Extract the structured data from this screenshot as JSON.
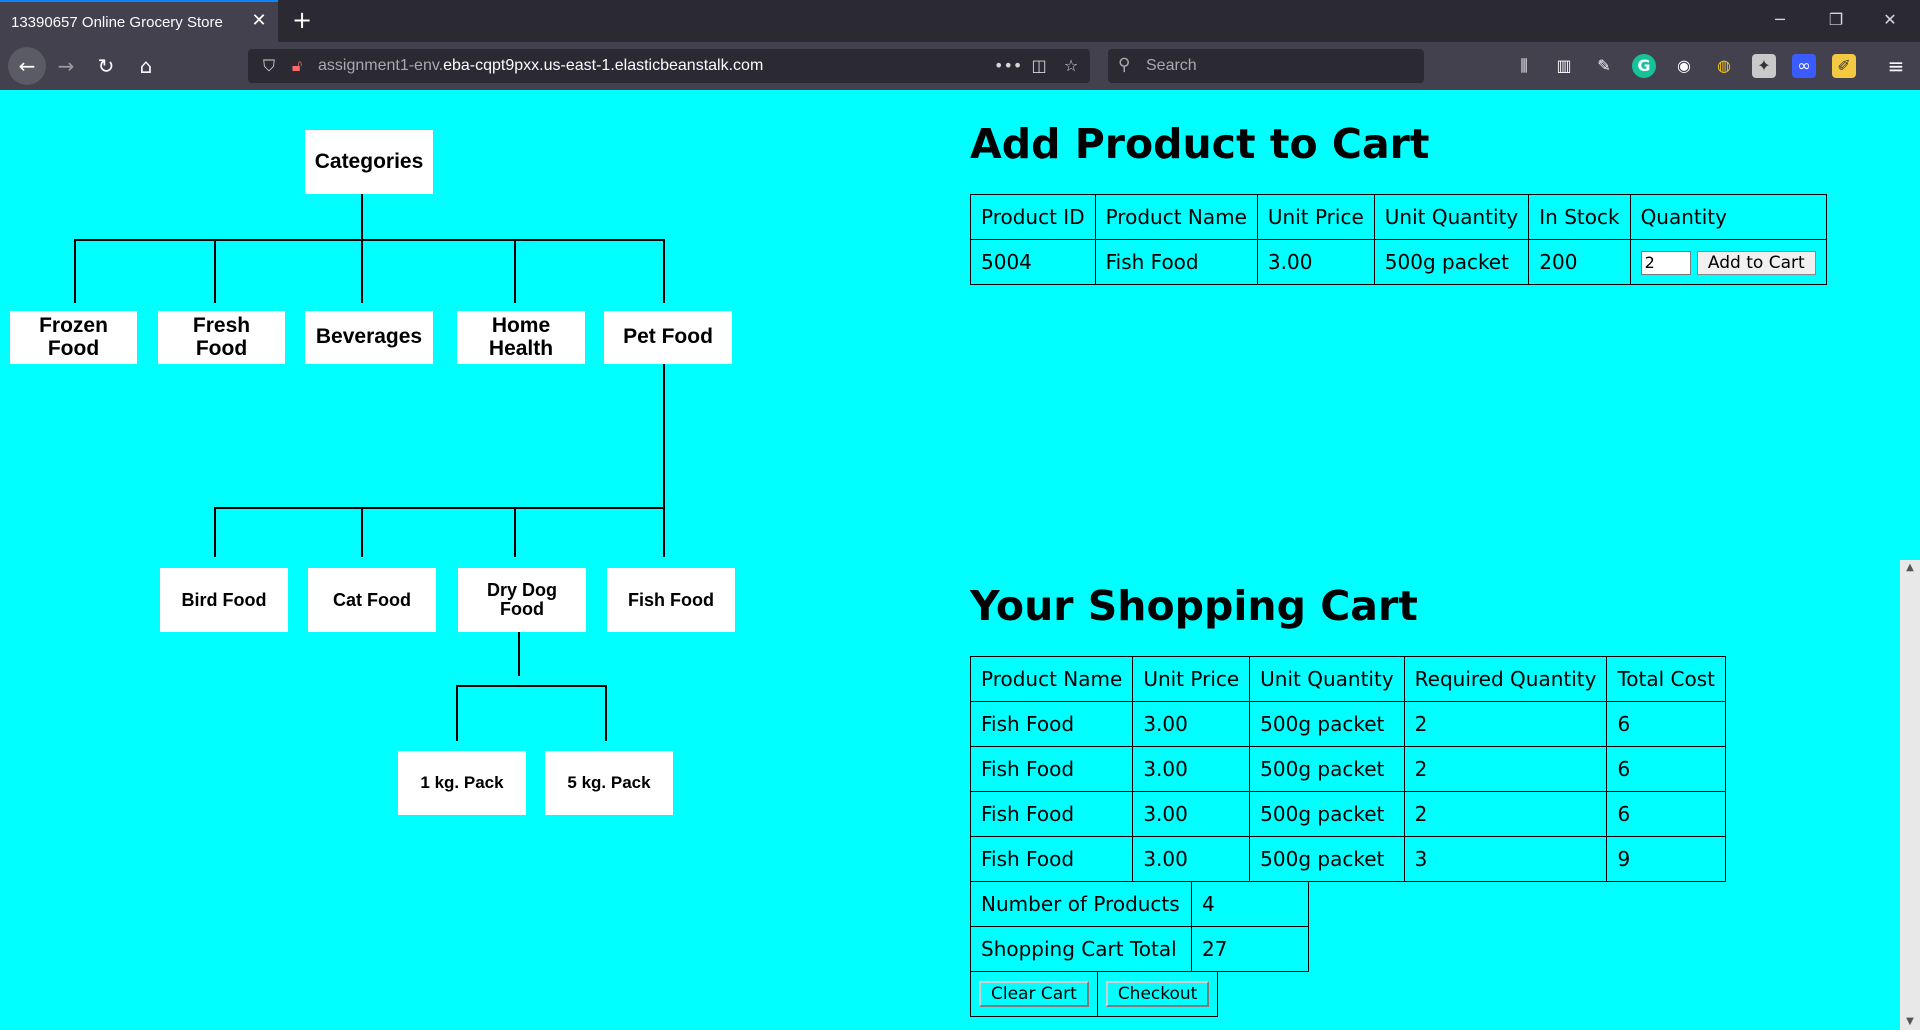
{
  "browser": {
    "tab_title": "13390657 Online Grocery Store",
    "tab_close": "✕",
    "new_tab": "+",
    "url_dim": "assignment1-env.",
    "url_main": "eba-cqpt9pxx.us-east-1.elasticbeanstalk.com",
    "search_placeholder": "Search"
  },
  "diagram": {
    "root": "Categories",
    "level1": [
      "Frozen\nFood",
      "Fresh\nFood",
      "Beverages",
      "Home\nHealth",
      "Pet Food"
    ],
    "pet": [
      "Bird Food",
      "Cat Food",
      "Dry Dog\nFood",
      "Fish Food"
    ],
    "dog": [
      "1 kg. Pack",
      "5 kg. Pack"
    ]
  },
  "add_product": {
    "heading": "Add Product to Cart",
    "headers": [
      "Product ID",
      "Product Name",
      "Unit Price",
      "Unit Quantity",
      "In Stock",
      "Quantity"
    ],
    "row": {
      "id": "5004",
      "name": "Fish Food",
      "price": "3.00",
      "unit": "500g packet",
      "stock": "200",
      "quantity_value": "2",
      "add_button": "Add to Cart"
    }
  },
  "cart": {
    "heading": "Your Shopping Cart",
    "headers": [
      "Product Name",
      "Unit Price",
      "Unit Quantity",
      "Required Quantity",
      "Total Cost"
    ],
    "rows": [
      [
        "Fish Food",
        "3.00",
        "500g packet",
        "2",
        "6"
      ],
      [
        "Fish Food",
        "3.00",
        "500g packet",
        "2",
        "6"
      ],
      [
        "Fish Food",
        "3.00",
        "500g packet",
        "2",
        "6"
      ],
      [
        "Fish Food",
        "3.00",
        "500g packet",
        "3",
        "9"
      ]
    ],
    "num_products_label": "Number of Products",
    "num_products": "4",
    "total_label": "Shopping Cart Total",
    "total": "27",
    "clear_button": "Clear Cart",
    "checkout_button": "Checkout"
  }
}
